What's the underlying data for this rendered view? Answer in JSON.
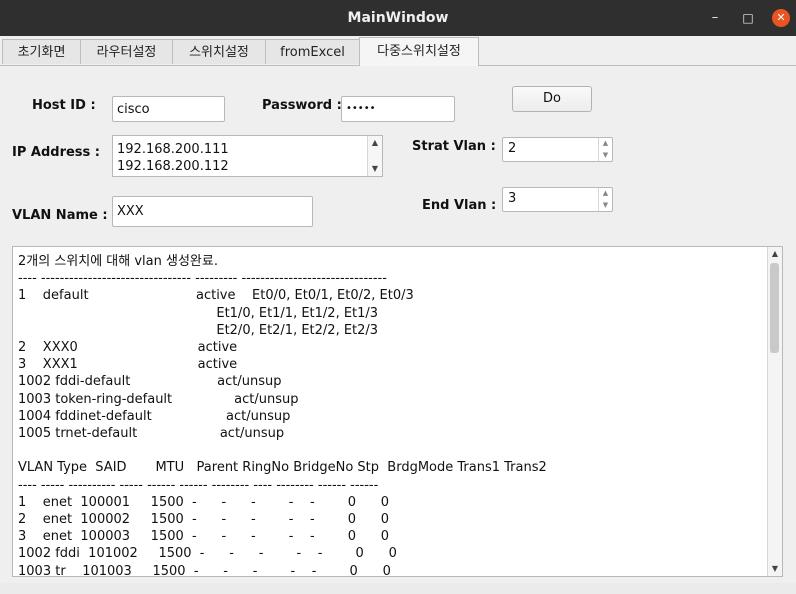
{
  "window": {
    "title": "MainWindow"
  },
  "window_controls": {
    "minimize": "–",
    "maximize": "□",
    "close": "✕"
  },
  "tabs": [
    {
      "label": "초기화면"
    },
    {
      "label": "라우터설정"
    },
    {
      "label": "스위치설정"
    },
    {
      "label": "fromExcel"
    },
    {
      "label": "다중스위치설정"
    }
  ],
  "form": {
    "host_label": "Host ID :",
    "host_value": "cisco",
    "password_label": "Password :",
    "password_value": "•••••",
    "do_label": "Do",
    "ip_label": "IP Address :",
    "ip_items": [
      "192.168.200.111",
      "192.168.200.112"
    ],
    "start_vlan_label": "Strat Vlan :",
    "start_vlan_value": "2",
    "end_vlan_label": "End Vlan :",
    "end_vlan_value": "3",
    "vlan_name_label": "VLAN Name :",
    "vlan_name_value": "XXX"
  },
  "icons": {
    "up": "▲",
    "down": "▼"
  },
  "output": {
    "text": "2개의 스위치에 대해 vlan 생성완료.\n---- -------------------------------- --------- -------------------------------\n1    default                          active    Et0/0, Et0/1, Et0/2, Et0/3\n                                                Et1/0, Et1/1, Et1/2, Et1/3\n                                                Et2/0, Et2/1, Et2/2, Et2/3\n2    XXX0                             active\n3    XXX1                             active\n1002 fddi-default                     act/unsup\n1003 token-ring-default               act/unsup\n1004 fddinet-default                  act/unsup\n1005 trnet-default                    act/unsup\n\nVLAN Type  SAID       MTU   Parent RingNo BridgeNo Stp  BrdgMode Trans1 Trans2\n---- ----- ---------- ----- ------ ------ -------- ---- -------- ------ ------\n1    enet  100001     1500  -      -      -        -    -        0      0\n2    enet  100002     1500  -      -      -        -    -        0      0\n3    enet  100003     1500  -      -      -        -    -        0      0\n1002 fddi  101002     1500  -      -      -        -    -        0      0\n1003 tr    101003     1500  -      -      -        -    -        0      0"
  }
}
